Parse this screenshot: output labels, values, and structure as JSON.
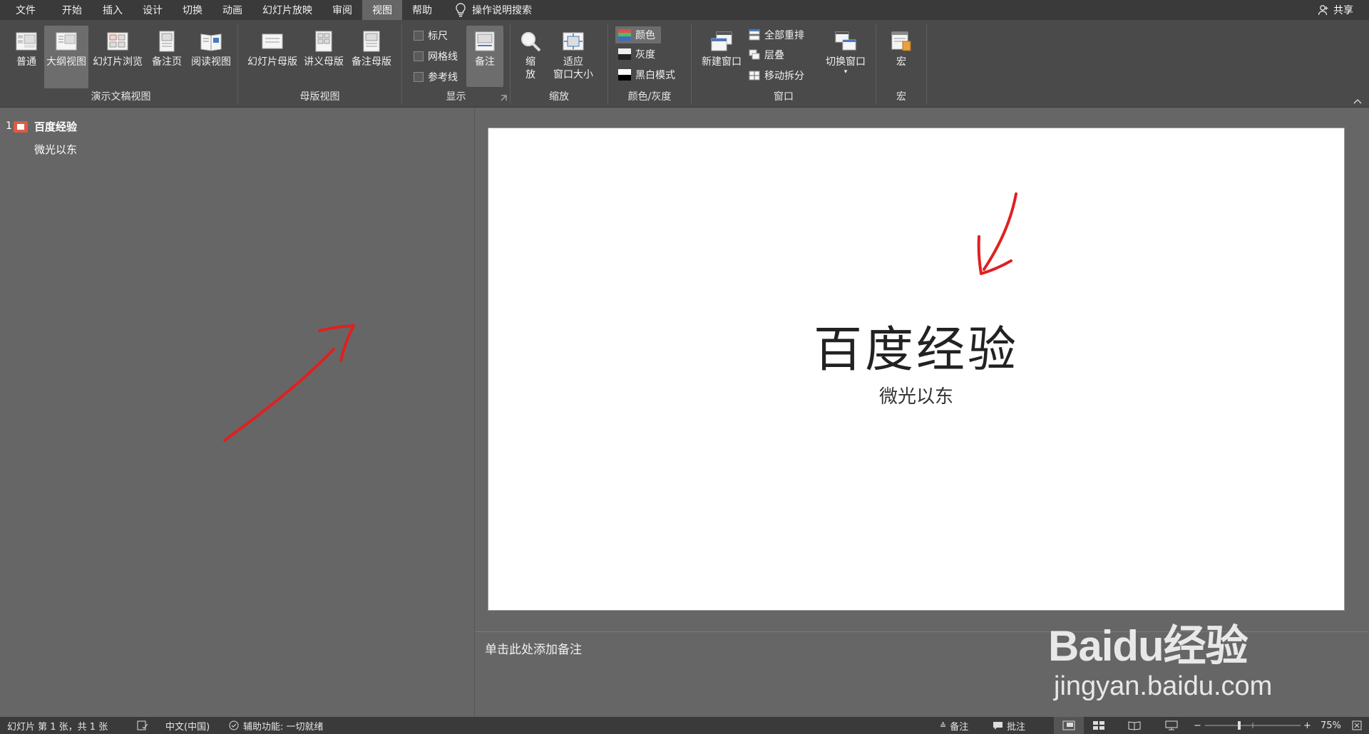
{
  "menu": {
    "tabs": [
      {
        "label": "文件"
      },
      {
        "label": "开始"
      },
      {
        "label": "插入"
      },
      {
        "label": "设计"
      },
      {
        "label": "切换"
      },
      {
        "label": "动画"
      },
      {
        "label": "幻灯片放映"
      },
      {
        "label": "审阅"
      },
      {
        "label": "视图"
      },
      {
        "label": "帮助"
      }
    ],
    "active_tab": "视图",
    "search_label": "操作说明搜索",
    "share_label": "共享"
  },
  "ribbon": {
    "presentation_views": {
      "label": "演示文稿视图",
      "buttons": [
        "普通",
        "大纲视图",
        "幻灯片浏览",
        "备注页",
        "阅读视图"
      ]
    },
    "master_views": {
      "label": "母版视图",
      "buttons": [
        "幻灯片母版",
        "讲义母版",
        "备注母版"
      ]
    },
    "show": {
      "label": "显示",
      "ruler": "标尺",
      "gridlines": "网格线",
      "guides": "参考线",
      "notes": "备注"
    },
    "zoom": {
      "label": "缩放",
      "zoom_btn_line1": "缩",
      "zoom_btn_line2": "放",
      "fit_line1": "适应",
      "fit_line2": "窗口大小"
    },
    "color": {
      "label": "颜色/灰度",
      "color": "颜色",
      "grayscale": "灰度",
      "bw": "黑白模式"
    },
    "window": {
      "label": "窗口",
      "new_window": "新建窗口",
      "arrange_all": "全部重排",
      "cascade": "层叠",
      "move_split": "移动拆分",
      "switch_windows": "切换窗口"
    },
    "macros": {
      "label": "宏",
      "macros": "宏"
    }
  },
  "outline": {
    "slide_number": "1",
    "title": "百度经验",
    "subtitle": "微光以东"
  },
  "slide": {
    "title": "百度经验",
    "subtitle": "微光以东"
  },
  "notes_placeholder": "单击此处添加备注",
  "status": {
    "slide_info": "幻灯片 第 1 张，共 1 张",
    "language": "中文(中国)",
    "accessibility": "辅助功能: 一切就绪",
    "notes": "备注",
    "comments": "批注",
    "zoom": "75%",
    "zoom_minus": "−",
    "zoom_plus": "+"
  },
  "watermark": {
    "line1": "Baidu经验",
    "line2": "jingyan.baidu.com"
  },
  "colors": {
    "annotation_arrow": "#e02020",
    "slide_icon": "#e05a44"
  }
}
